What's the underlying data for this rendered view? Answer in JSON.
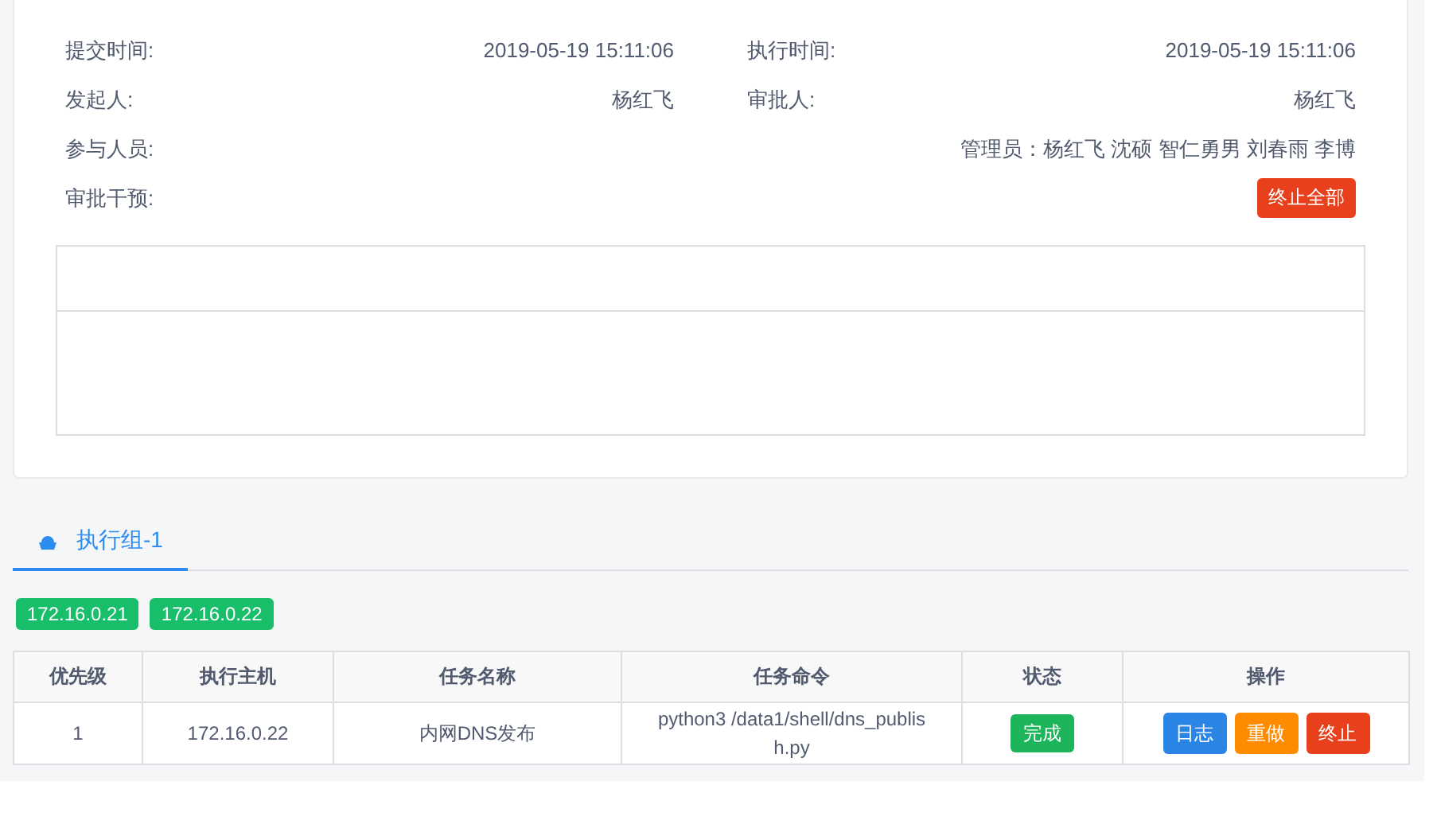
{
  "info": [
    {
      "label": "提交时间:",
      "kind": "text",
      "value": "2019-05-19 15:11:06"
    },
    {
      "label": "执行时间:",
      "kind": "text",
      "value": "2019-05-19 15:11:06"
    },
    {
      "label": "发起人:",
      "kind": "text",
      "value": "杨红飞"
    },
    {
      "label": "审批人:",
      "kind": "text",
      "value": "杨红飞"
    },
    {
      "label": "参与人员:",
      "kind": "wide",
      "value": "管理员：杨红飞 沈硕 智仁勇男 刘春雨 李博"
    },
    {
      "label": "审批干预:",
      "kind": "button",
      "value": "终止全部"
    }
  ],
  "tabs": [
    {
      "label": "执行组-1",
      "selected": true
    }
  ],
  "hosts": [
    "172.16.0.21",
    "172.16.0.22"
  ],
  "table": {
    "columns": [
      "优先级",
      "执行主机",
      "任务名称",
      "任务命令",
      "状态",
      "操作"
    ],
    "rows": [
      {
        "priority": "1",
        "host": "172.16.0.22",
        "name": "内网DNS发布",
        "command": "python3 /data1/shell/dns_publish.py",
        "status": {
          "label": "完成",
          "color": "#1db55b"
        },
        "actions": [
          {
            "label": "日志",
            "color": "#2b85e4"
          },
          {
            "label": "重做",
            "color": "#ff8c00"
          },
          {
            "label": "终止",
            "color": "#e8401c"
          }
        ]
      }
    ]
  }
}
